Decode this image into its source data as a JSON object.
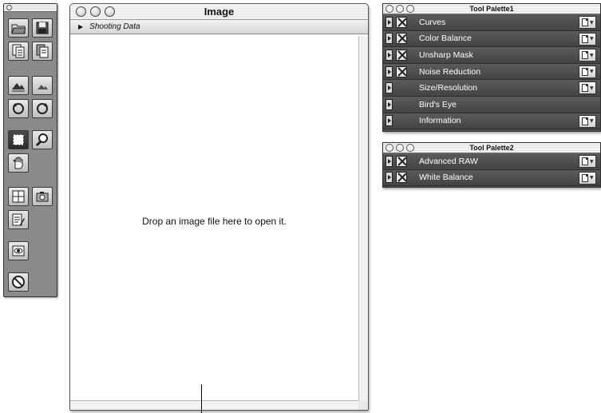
{
  "toolbar": {
    "buttons": [
      {
        "name": "open-folder-icon"
      },
      {
        "name": "save-icon"
      },
      {
        "name": "copy-document-icon"
      },
      {
        "name": "paste-document-icon"
      },
      {
        "name": "mountain-large-icon"
      },
      {
        "name": "mountain-small-icon"
      },
      {
        "name": "rotate-left-icon"
      },
      {
        "name": "rotate-right-icon"
      },
      {
        "name": "marquee-select-icon"
      },
      {
        "name": "zoom-icon"
      },
      {
        "name": "hand-tool-icon"
      },
      {
        "name": "grid-view-icon"
      },
      {
        "name": "camera-settings-icon"
      },
      {
        "name": "edit-document-icon"
      },
      {
        "name": "eye-preview-icon"
      },
      {
        "name": "stop-icon"
      }
    ]
  },
  "image_window": {
    "title": "Image",
    "shooting_data_label": "Shooting Data",
    "drop_message": "Drop an image file here to open it."
  },
  "palette1": {
    "title": "Tool Palette1",
    "rows": [
      {
        "label": "Curves",
        "checkbox": true,
        "menu": true
      },
      {
        "label": "Color Balance",
        "checkbox": true,
        "menu": true
      },
      {
        "label": "Unsharp Mask",
        "checkbox": true,
        "menu": true
      },
      {
        "label": "Noise Reduction",
        "checkbox": true,
        "menu": true
      },
      {
        "label": "Size/Resolution",
        "checkbox": false,
        "menu": true
      },
      {
        "label": "Bird's Eye",
        "checkbox": false,
        "menu": false
      },
      {
        "label": "Information",
        "checkbox": false,
        "menu": true
      }
    ]
  },
  "palette2": {
    "title": "Tool Palette2",
    "rows": [
      {
        "label": "Advanced RAW",
        "checkbox": true,
        "menu": true
      },
      {
        "label": "White Balance",
        "checkbox": true,
        "menu": true
      }
    ]
  }
}
